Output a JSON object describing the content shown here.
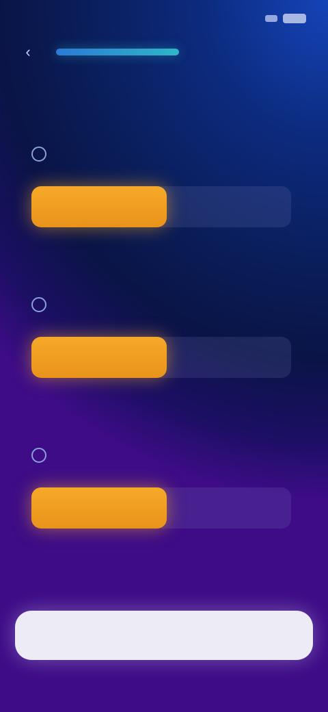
{
  "status_bar": {
    "time": ""
  },
  "header": {
    "brand": "",
    "title": ""
  },
  "metrics": [
    {
      "label": "",
      "level_percent": 52,
      "footer_left": "",
      "footer_right": ""
    },
    {
      "label": "",
      "level_percent": 52,
      "footer_left": "",
      "footer_right": ""
    },
    {
      "label": "",
      "level_percent": 52,
      "footer_left": "",
      "footer_right": ""
    }
  ],
  "actions": {
    "primary_label": ""
  },
  "colors": {
    "accent": "#f6a928",
    "brand_line": "#2fb6c7",
    "button_bg": "#ecebf6"
  }
}
